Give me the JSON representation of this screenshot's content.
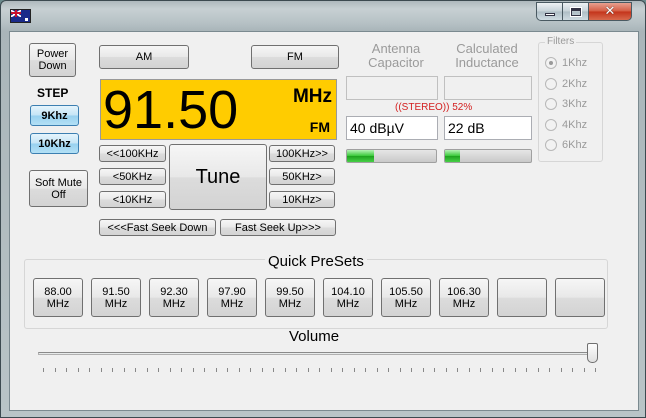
{
  "titlebar": {
    "icon": "flag-icon"
  },
  "buttons": {
    "power": "Power Down",
    "am": "AM",
    "fm": "FM",
    "soft_mute": "Soft Mute Off",
    "tune": "Tune",
    "fast_seek_down": "<<<Fast Seek Down",
    "fast_seek_up": "Fast Seek Up>>>",
    "down_100": "<<100KHz",
    "down_50": "<50KHz",
    "down_10": "<10KHz",
    "up_100": "100KHz>>",
    "up_50": "50KHz>",
    "up_10": "10KHz>"
  },
  "step": {
    "title": "STEP",
    "options": [
      "9Khz",
      "10Khz"
    ],
    "selected": "10Khz"
  },
  "display": {
    "frequency": "91.50",
    "unit": "MHz",
    "band": "FM"
  },
  "antenna": {
    "label": "Antenna Capacitor",
    "value": ""
  },
  "inductance": {
    "label": "Calculated Inductance",
    "value": ""
  },
  "signal": {
    "stereo_text": "((STEREO)) 52%",
    "level": "40 dBµV",
    "snr": "22 dB",
    "level_meter": 0.3,
    "snr_meter": 0.17
  },
  "filters": {
    "title": "Filters",
    "options": [
      "1Khz",
      "2Khz",
      "3Khz",
      "4Khz",
      "6Khz"
    ],
    "selected": "1Khz"
  },
  "presets": {
    "title": "Quick PreSets",
    "items": [
      "88.00 MHz",
      "91.50 MHz",
      "92.30 MHz",
      "97.90 MHz",
      "99.50 MHz",
      "104.10 MHz",
      "105.50 MHz",
      "106.30 MHz",
      "",
      ""
    ]
  },
  "volume": {
    "title": "Volume",
    "value": 1.0
  },
  "colors": {
    "display_bg": "#ffcc00",
    "stereo_text": "#d32020",
    "meter_fill": "#37c837"
  }
}
